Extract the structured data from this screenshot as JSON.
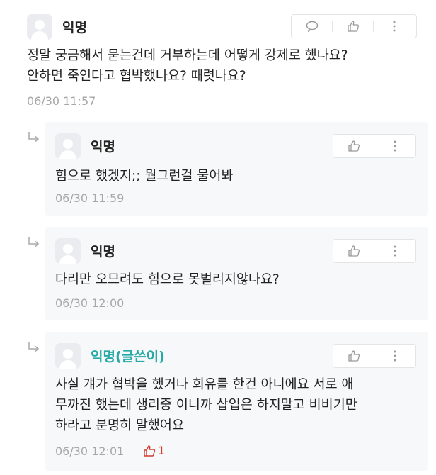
{
  "post": {
    "author": "익명",
    "lines": [
      "정말 궁금해서 묻는건데 거부하는데 어떻게 강제로 했나요?",
      "안하면 죽인다고 협박했나요? 때렷나요?"
    ],
    "time": "06/30 11:57"
  },
  "replies": [
    {
      "author": "익명",
      "lines": [
        "힘으로 했겠지;; 뭘그런걸 물어봐"
      ],
      "time": "06/30 11:59"
    },
    {
      "author": "익명",
      "lines": [
        "다리만 오므려도 힘으로 못벌리지않나요?"
      ],
      "time": "06/30 12:00"
    },
    {
      "author": "익명(글쓴이)",
      "lines": [
        "사실 걔가 협박을 했거나 회유를 한건 아니에요 서로 애",
        "무까진 했는데 생리중 이니까 삽입은 하지말고 비비기만",
        "하라고 분명히 말했어요"
      ],
      "time": "06/30 12:01",
      "likes": "1"
    }
  ],
  "colors": {
    "author_name": "#27a9a7",
    "like_count": "#d33b2f",
    "timestamp": "#a7a7a7",
    "reply_bg": "#f7f8f9"
  }
}
